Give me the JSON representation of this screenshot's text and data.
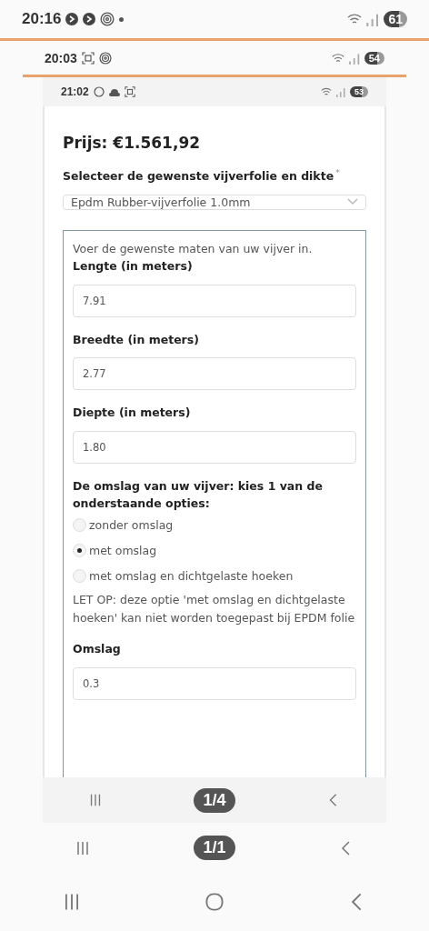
{
  "outer": {
    "status_bar": {
      "time": "20:16",
      "battery": "61"
    }
  },
  "screenshot": {
    "status_bar": {
      "time": "20:03",
      "battery": "54"
    },
    "page_counter": "1/1",
    "inner": {
      "status_bar": {
        "time": "21:02",
        "battery": "53"
      },
      "page_counter": "1/4",
      "page": {
        "price": "Prijs: €1.561,92",
        "select_label": "Selecteer de gewenste vijverfolie en dikte",
        "required_mark": "*",
        "select_value": "Epdm Rubber-vijverfolie 1.0mm",
        "intro": "Voer de gewenste maten van uw vijver in.",
        "fields": [
          {
            "label": "Lengte (in meters)",
            "value": "7.91"
          },
          {
            "label": "Breedte (in meters)",
            "value": "2.77"
          },
          {
            "label": "Diepte (in meters)",
            "value": "1.80"
          }
        ],
        "omslag_question": "De omslag van uw vijver: kies 1 van de onderstaande opties:",
        "options": [
          {
            "label": "zonder omslag",
            "selected": false
          },
          {
            "label": "met omslag",
            "selected": true
          },
          {
            "label": "met omslag en dichtgelaste hoeken",
            "selected": false
          }
        ],
        "note": "LET OP: deze optie 'met omslag en dichtgelaste hoeken' kan niet worden toegepast bij EPDM folie",
        "omslag_field": {
          "label": "Omslag",
          "value": "0.3"
        }
      }
    }
  }
}
